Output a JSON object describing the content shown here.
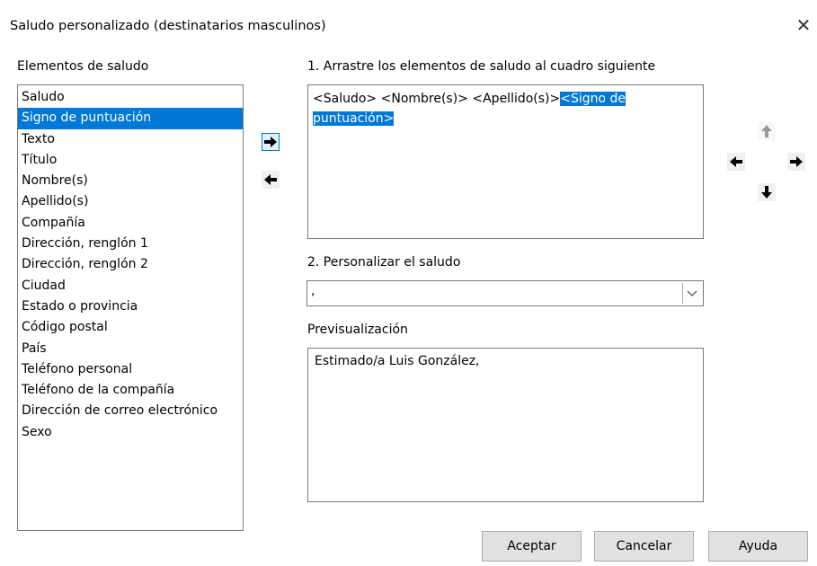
{
  "window": {
    "title": "Saludo personalizado (destinatarios masculinos)"
  },
  "elements_label": "Elementos de saludo",
  "elements": [
    "Saludo",
    "Signo de puntuación",
    "Texto",
    "Título",
    "Nombre(s)",
    "Apellido(s)",
    "Compañía",
    "Dirección, renglón 1",
    "Dirección, renglón 2",
    "Ciudad",
    "Estado o provincia",
    "Código postal",
    "País",
    "Teléfono personal",
    "Teléfono de la compañía",
    "Dirección de correo electrónico",
    "Sexo"
  ],
  "selected_element": "Signo de puntuación",
  "step1": {
    "label": "1. Arrastre los elementos de saludo al cuadro siguiente",
    "tokens": {
      "saludo": "<Saludo>",
      "nombre": "<Nombre(s)>",
      "apellido": "<Apellido(s)>",
      "signo_line1": "<Signo de",
      "signo_line2": "puntuación>"
    }
  },
  "step2": {
    "label": "2. Personalizar el saludo",
    "value": ","
  },
  "preview": {
    "label": "Previsualización",
    "text": "Estimado/a Luis González,"
  },
  "buttons": {
    "ok": "Aceptar",
    "cancel": "Cancelar",
    "help": "Ayuda"
  },
  "icons": {
    "add": "arrow-right-icon",
    "remove": "arrow-left-icon",
    "move_up": "arrow-up-icon",
    "move_left": "arrow-left-icon",
    "move_right": "arrow-right-icon",
    "move_down": "arrow-down-icon",
    "close": "close-icon"
  },
  "colors": {
    "selection": "#0078d7",
    "button_bg": "#e1e1e1",
    "border": "#7a7a7a"
  }
}
